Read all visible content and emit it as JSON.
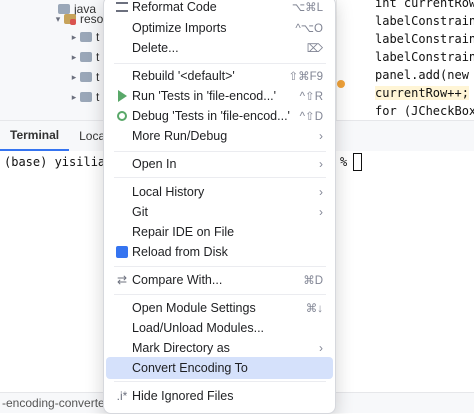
{
  "project_tree": {
    "rows": [
      {
        "label": "java"
      },
      {
        "label": "reso"
      },
      {
        "label": "t"
      },
      {
        "label": "t"
      },
      {
        "label": "t"
      },
      {
        "label": "t"
      }
    ]
  },
  "tool_tabs": {
    "terminal": "Terminal",
    "local": "Local"
  },
  "terminal": {
    "prompt": "(base) yisiliang",
    "prompt_end": "%"
  },
  "code_editor": {
    "lines": [
      "int currentRow",
      "labelConstraints",
      "labelConstraints",
      "labelConstraints",
      "panel.add(new JL",
      "currentRow++;",
      "for (JCheckBox c"
    ]
  },
  "status_bar": {
    "path": "-encoding-converter"
  },
  "context_menu": {
    "items": [
      {
        "label": "Reformat Code",
        "shortcut": "⌥⌘L"
      },
      {
        "label": "Optimize Imports",
        "shortcut": "^⌥O"
      },
      {
        "label": "Delete...",
        "shortcut": "⌦"
      },
      {
        "label": "Rebuild '<default>'",
        "shortcut": "⇧⌘F9"
      },
      {
        "label": "Run 'Tests in 'file-encod...'",
        "shortcut": "^⇧R"
      },
      {
        "label": "Debug 'Tests in 'file-encod...'",
        "shortcut": "^⇧D"
      },
      {
        "label": "More Run/Debug",
        "shortcut": ""
      },
      {
        "label": "Open In",
        "shortcut": ""
      },
      {
        "label": "Local History",
        "shortcut": ""
      },
      {
        "label": "Git",
        "shortcut": ""
      },
      {
        "label": "Repair IDE on File",
        "shortcut": ""
      },
      {
        "label": "Reload from Disk",
        "shortcut": ""
      },
      {
        "label": "Compare With...",
        "shortcut": "⌘D"
      },
      {
        "label": "Open Module Settings",
        "shortcut": "⌘↓"
      },
      {
        "label": "Load/Unload Modules...",
        "shortcut": ""
      },
      {
        "label": "Mark Directory as",
        "shortcut": ""
      },
      {
        "label": "Convert Encoding To",
        "shortcut": ""
      },
      {
        "label": "Hide Ignored Files",
        "shortcut": ""
      }
    ],
    "icons": {
      "reformat": "reformat-code-icon",
      "run": "run-icon",
      "debug": "debug-icon",
      "reload": "reload-icon",
      "compare": "compare-icon",
      "hide": "hide-ignored-icon"
    }
  }
}
